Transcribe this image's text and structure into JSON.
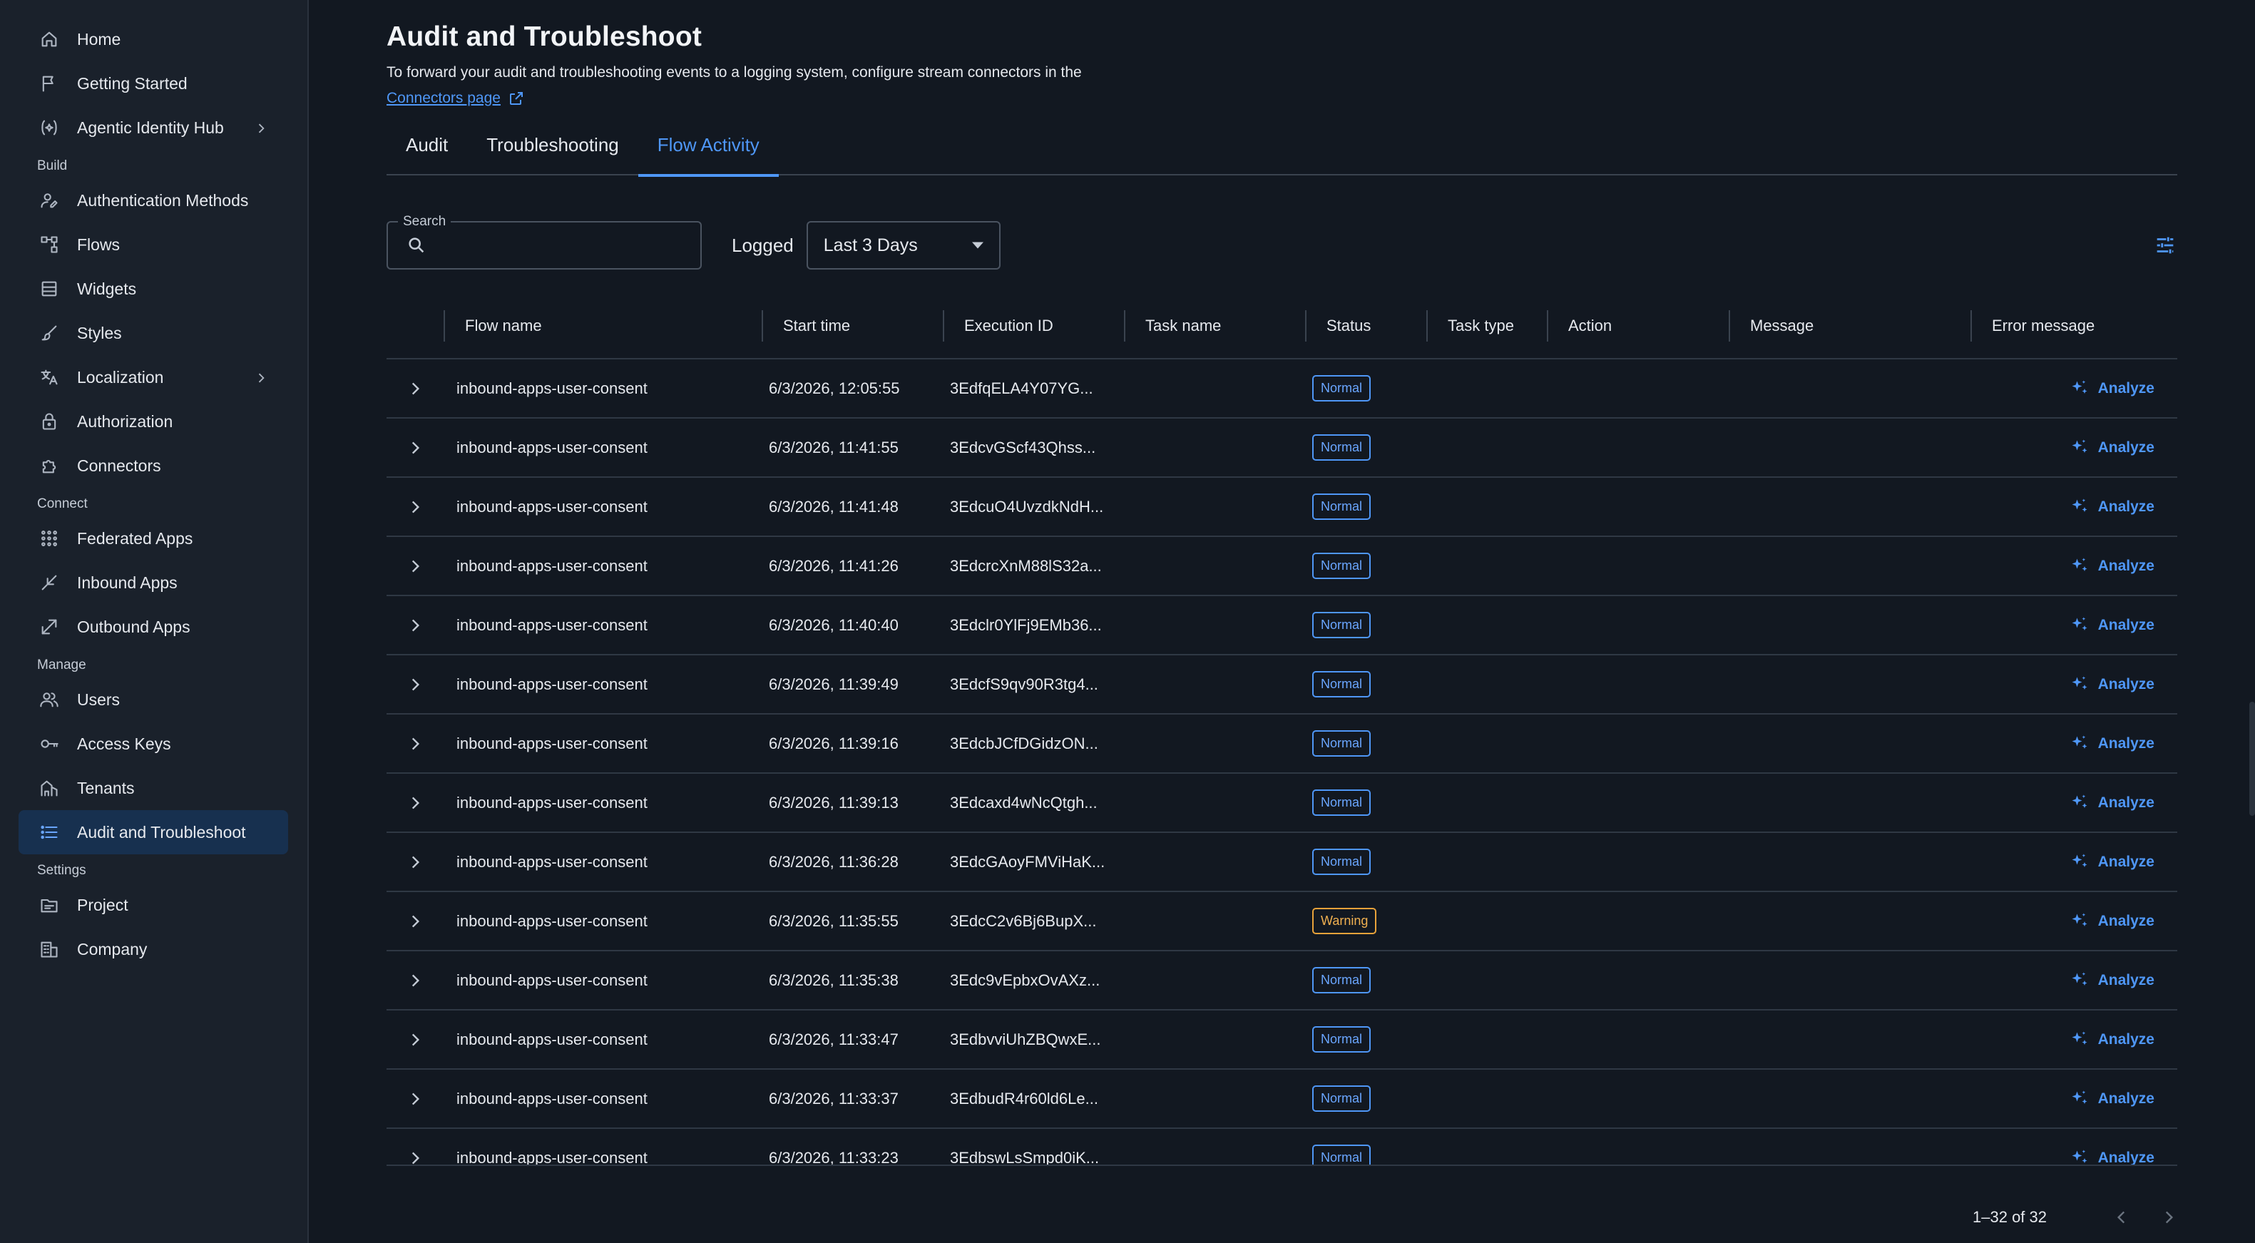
{
  "sidebar": {
    "top_items": [
      {
        "label": "Home",
        "icon": "home-icon"
      },
      {
        "label": "Getting Started",
        "icon": "flag-icon"
      },
      {
        "label": "Agentic Identity Hub",
        "icon": "agent-icon",
        "expandable": true
      }
    ],
    "sections": [
      {
        "title": "Build",
        "items": [
          {
            "label": "Authentication Methods",
            "icon": "user-key-icon"
          },
          {
            "label": "Flows",
            "icon": "flows-icon"
          },
          {
            "label": "Widgets",
            "icon": "widgets-icon"
          },
          {
            "label": "Styles",
            "icon": "brush-icon"
          },
          {
            "label": "Localization",
            "icon": "translate-icon",
            "expandable": true
          },
          {
            "label": "Authorization",
            "icon": "lock-icon"
          },
          {
            "label": "Connectors",
            "icon": "puzzle-icon"
          }
        ]
      },
      {
        "title": "Connect",
        "items": [
          {
            "label": "Federated Apps",
            "icon": "apps-grid-icon"
          },
          {
            "label": "Inbound Apps",
            "icon": "inbound-arrow-icon"
          },
          {
            "label": "Outbound Apps",
            "icon": "outbound-arrow-icon"
          }
        ]
      },
      {
        "title": "Manage",
        "items": [
          {
            "label": "Users",
            "icon": "users-icon"
          },
          {
            "label": "Access Keys",
            "icon": "key-icon"
          },
          {
            "label": "Tenants",
            "icon": "tenants-icon"
          },
          {
            "label": "Audit and Troubleshoot",
            "icon": "list-icon",
            "active": true
          }
        ]
      },
      {
        "title": "Settings",
        "items": [
          {
            "label": "Project",
            "icon": "project-icon"
          },
          {
            "label": "Company",
            "icon": "company-icon"
          }
        ]
      }
    ]
  },
  "page": {
    "title": "Audit and Troubleshoot",
    "subtitle": "To forward your audit and troubleshooting events to a logging system, configure stream connectors in the",
    "link_label": "Connectors page"
  },
  "tabs": [
    {
      "label": "Audit",
      "active": false
    },
    {
      "label": "Troubleshooting",
      "active": false
    },
    {
      "label": "Flow Activity",
      "active": true
    }
  ],
  "filters": {
    "search_label": "Search",
    "search_value": "",
    "logged_label": "Logged",
    "logged_value": "Last 3 Days"
  },
  "table": {
    "columns": [
      "Flow name",
      "Start time",
      "Execution ID",
      "Task name",
      "Status",
      "Task type",
      "Action",
      "Message",
      "Error message"
    ],
    "analyze_label": "Analyze",
    "rows": [
      {
        "flow": "inbound-apps-user-consent",
        "start": "6/3/2026, 12:05:55",
        "exec": "3EdfqELA4Y07YG...",
        "status": "Normal"
      },
      {
        "flow": "inbound-apps-user-consent",
        "start": "6/3/2026, 11:41:55",
        "exec": "3EdcvGScf43Qhss...",
        "status": "Normal"
      },
      {
        "flow": "inbound-apps-user-consent",
        "start": "6/3/2026, 11:41:48",
        "exec": "3EdcuO4UvzdkNdH...",
        "status": "Normal"
      },
      {
        "flow": "inbound-apps-user-consent",
        "start": "6/3/2026, 11:41:26",
        "exec": "3EdcrcXnM88lS32a...",
        "status": "Normal"
      },
      {
        "flow": "inbound-apps-user-consent",
        "start": "6/3/2026, 11:40:40",
        "exec": "3Edclr0YlFj9EMb36...",
        "status": "Normal"
      },
      {
        "flow": "inbound-apps-user-consent",
        "start": "6/3/2026, 11:39:49",
        "exec": "3EdcfS9qv90R3tg4...",
        "status": "Normal"
      },
      {
        "flow": "inbound-apps-user-consent",
        "start": "6/3/2026, 11:39:16",
        "exec": "3EdcbJCfDGidzON...",
        "status": "Normal"
      },
      {
        "flow": "inbound-apps-user-consent",
        "start": "6/3/2026, 11:39:13",
        "exec": "3Edcaxd4wNcQtgh...",
        "status": "Normal"
      },
      {
        "flow": "inbound-apps-user-consent",
        "start": "6/3/2026, 11:36:28",
        "exec": "3EdcGAoyFMViHaK...",
        "status": "Normal"
      },
      {
        "flow": "inbound-apps-user-consent",
        "start": "6/3/2026, 11:35:55",
        "exec": "3EdcC2v6Bj6BupX...",
        "status": "Warning"
      },
      {
        "flow": "inbound-apps-user-consent",
        "start": "6/3/2026, 11:35:38",
        "exec": "3Edc9vEpbxOvAXz...",
        "status": "Normal"
      },
      {
        "flow": "inbound-apps-user-consent",
        "start": "6/3/2026, 11:33:47",
        "exec": "3EdbvviUhZBQwxE...",
        "status": "Normal"
      },
      {
        "flow": "inbound-apps-user-consent",
        "start": "6/3/2026, 11:33:37",
        "exec": "3EdbudR4r60ld6Le...",
        "status": "Normal"
      },
      {
        "flow": "inbound-apps-user-consent",
        "start": "6/3/2026, 11:33:23",
        "exec": "3EdbswLsSmpd0iK...",
        "status": "Normal"
      }
    ]
  },
  "pagination": {
    "text": "1–32 of 32"
  },
  "colors": {
    "accent": "#4f97f7",
    "warning": "#e8a23a",
    "background": "#121821",
    "sidebar": "#1a212b"
  }
}
